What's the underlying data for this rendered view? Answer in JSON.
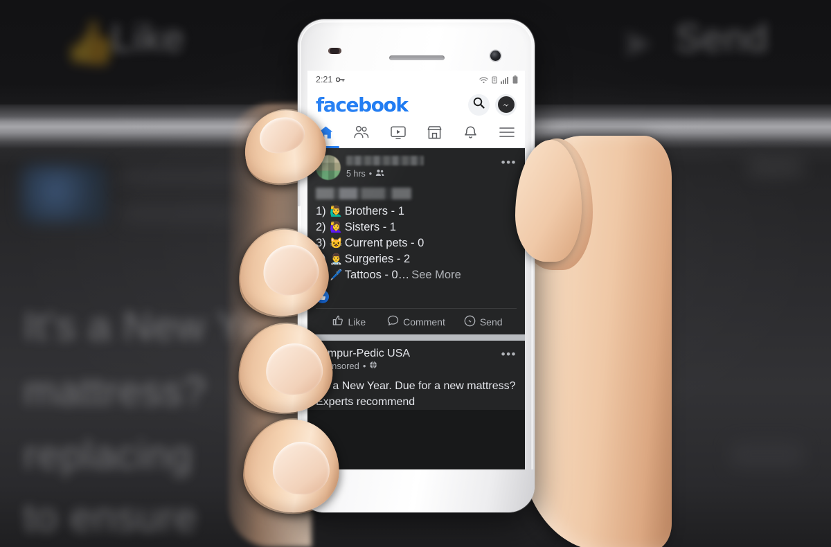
{
  "background": {
    "like_label": "Like",
    "send_label": "Send",
    "like_icon": "thumbs-up-icon",
    "send_icon": "messenger-icon",
    "lines": [
      "It's a New Year",
      "mattress?",
      "replacing",
      "to ensure"
    ]
  },
  "phone": {
    "statusbar": {
      "time": "2:21",
      "key_icon": "vpn-key-icon",
      "wifi_icon": "wifi-icon",
      "sim_icon": "sim-card-icon",
      "signal_icon": "cellular-signal-icon",
      "battery_icon": "battery-icon"
    },
    "header": {
      "logo": "facebook",
      "search_icon": "search-icon",
      "messenger_icon": "messenger-icon",
      "brand_color": "#1877F2"
    },
    "tabs": [
      {
        "name": "home",
        "icon": "home-icon",
        "active": true
      },
      {
        "name": "friends",
        "icon": "friends-icon",
        "active": false
      },
      {
        "name": "watch",
        "icon": "watch-video-icon",
        "active": false
      },
      {
        "name": "marketplace",
        "icon": "marketplace-icon",
        "active": false
      },
      {
        "name": "notifications",
        "icon": "bell-icon",
        "active": false
      },
      {
        "name": "menu",
        "icon": "hamburger-menu-icon",
        "active": false
      }
    ],
    "feed": {
      "post": {
        "author_redacted": true,
        "timestamp": "5 hrs",
        "audience_icon": "friends-audience-icon",
        "separator": "•",
        "more_options": "•••",
        "title_redacted": true,
        "items": [
          {
            "num": "1)",
            "emoji": "🙋‍♂️",
            "text": "Brothers - 1"
          },
          {
            "num": "2)",
            "emoji": "🙋‍♀️",
            "text": "Sisters - 1"
          },
          {
            "num": "3)",
            "emoji": "😺",
            "text": "Current pets - 0"
          },
          {
            "num": "4)",
            "emoji": "👨‍⚕️",
            "text": "Surgeries -  2"
          },
          {
            "num": "5)",
            "emoji": "🖊️",
            "text": "Tattoos - 0…"
          }
        ],
        "see_more": "See More",
        "reaction_icon": "like-reaction-icon",
        "actions": [
          {
            "label": "Like",
            "icon": "thumbs-up-outline-icon"
          },
          {
            "label": "Comment",
            "icon": "comment-bubble-icon"
          },
          {
            "label": "Send",
            "icon": "messenger-send-icon"
          }
        ]
      },
      "ad": {
        "advertiser": "Tempur-Pedic USA",
        "sponsored_label": "Sponsored",
        "separator": "•",
        "globe_icon": "globe-public-icon",
        "more_options": "•••",
        "body": "It's a New Year. Due for a new mattress? Experts recommend"
      }
    }
  }
}
